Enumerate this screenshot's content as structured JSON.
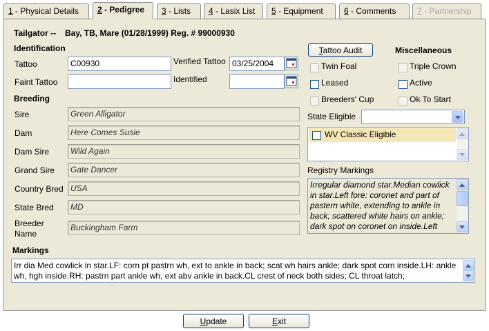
{
  "tabs": [
    {
      "key": "1",
      "label": " - Physical Details"
    },
    {
      "key": "2",
      "label": " - Pedigree"
    },
    {
      "key": "3",
      "label": " - Lists"
    },
    {
      "key": "4",
      "label": " - Lasix List"
    },
    {
      "key": "5",
      "label": " - Equipment"
    },
    {
      "key": "6",
      "label": " - Comments"
    },
    {
      "key": "7",
      "label": " - Partnership"
    }
  ],
  "header": {
    "horse_name": "Tailgator --",
    "horse_details": "Bay, TB, Mare (01/28/1999) Reg. # 99000930"
  },
  "identification": {
    "section_label": "Identification",
    "tattoo_label": "Tattoo",
    "tattoo_value": "C00930",
    "verified_tattoo_label": "Verified Tattoo",
    "verified_tattoo_value": "03/25/2004",
    "faint_tattoo_label": "Faint Tattoo",
    "faint_tattoo_value": "",
    "identified_label": "Identified",
    "identified_value": ""
  },
  "breeding": {
    "section_label": "Breeding",
    "sire_label": "Sire",
    "sire_value": "Green Alligator",
    "dam_label": "Dam",
    "dam_value": "Here Comes Susie",
    "dam_sire_label": "Dam Sire",
    "dam_sire_value": "Wild Again",
    "grand_sire_label": "Grand Sire",
    "grand_sire_value": "Gate Dancer",
    "country_bred_label": "Country Bred",
    "country_bred_value": "USA",
    "state_bred_label": "State Bred",
    "state_bred_value": "MD",
    "breeder_name_label_1": "Breeder",
    "breeder_name_label_2": "Name",
    "breeder_name_value": "Buckingham Farm"
  },
  "misc": {
    "tattoo_audit_prefix": "T",
    "tattoo_audit_rest": "attoo Audit",
    "section_label": "Miscellaneous",
    "twin_foal": "Twin Foal",
    "triple_crown": "Triple Crown",
    "leased": "Leased",
    "active": "Active",
    "breeders_cup": "Breeders' Cup",
    "ok_to_start": "Ok To Start",
    "state_eligible_label": "State Eligible",
    "state_eligible_value": "",
    "wv_classic": "WV Classic Eligible",
    "registry_markings_label": "Registry Markings",
    "registry_markings_text": "Irregular diamond star.Median cowlick in star.Left fore: coronet and part of pastern white, extending to ankle in back; scattered white hairs on ankle; dark spot on coronet on inside.Left"
  },
  "markings": {
    "label": "Markings",
    "text": "Irr dia  Med cowlick in star.LF: corn pt pastrn wh, ext to ankle in back; scat wh hairs ankle; dark spot corn inside.LH: ankle wh, hgh inside.RH: pastrn part ankle wh, ext abv ankle in back.CL crest of neck both sides; CL throat latch;"
  },
  "footer": {
    "update_prefix": "U",
    "update_rest": "pdate",
    "exit_prefix": "E",
    "exit_rest": "xit"
  },
  "colors": {
    "accent_border": "#7f9db9",
    "panel_bg": "#ece9d8",
    "highlight_bg": "#f5e6b6"
  }
}
